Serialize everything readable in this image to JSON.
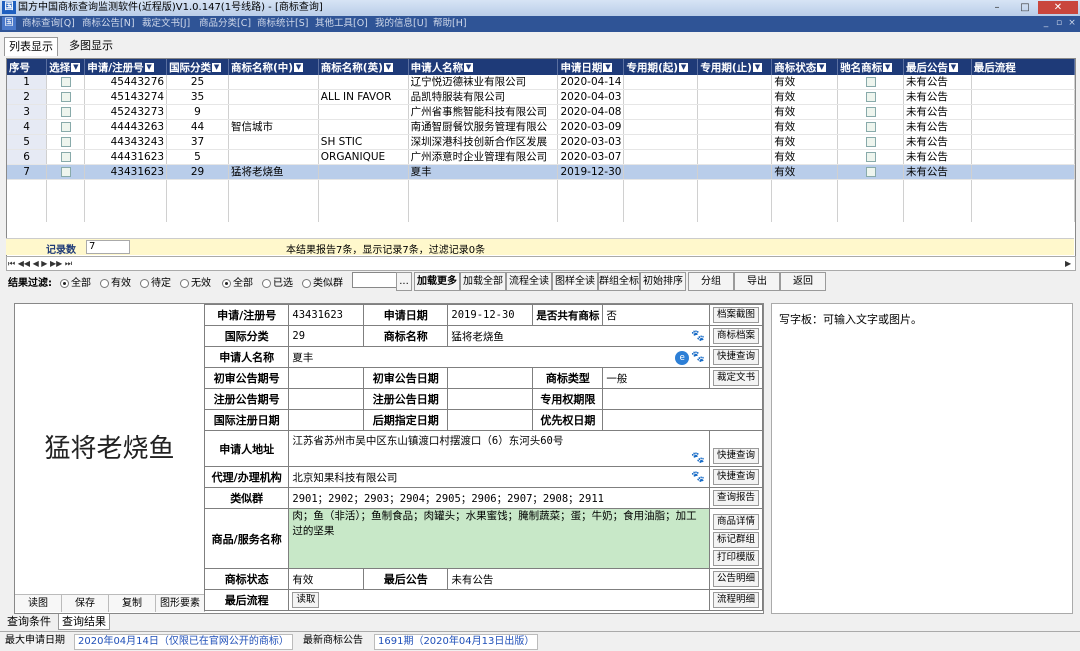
{
  "window": {
    "title": "国方中国商标查询监测软件(近程版)V1.0.147(1号线路) - [商标查询]",
    "app_icon": "国",
    "minimize": "–",
    "maximize": "□",
    "close": "✕"
  },
  "menu": [
    "商标查询[Q]",
    "商标公告[N]",
    "裁定文书[J]",
    "商品分类[C]",
    "商标统计[S]",
    "其他工具[O]",
    "我的信息[U]",
    "帮助[H]"
  ],
  "mdi_controls": [
    "_",
    "▫",
    "×"
  ],
  "view_tabs": {
    "list": "列表显示",
    "multi": "多图显示"
  },
  "grid": {
    "columns": [
      "序号",
      "选择",
      "申请/注册号",
      "国际分类",
      "商标名称(中)",
      "商标名称(英)",
      "申请人名称",
      "申请日期",
      "专用期(起)",
      "专用期(止)",
      "商标状态",
      "驰名商标",
      "最后公告",
      "最后流程"
    ],
    "rows": [
      {
        "no": "1",
        "reg": "45443276",
        "cls": "25",
        "cn": "",
        "en": "",
        "applicant": "辽宁悦迈德袜业有限公司",
        "date": "2020-04-14",
        "status": "有效",
        "notice": "未有公告"
      },
      {
        "no": "2",
        "reg": "45143274",
        "cls": "35",
        "cn": "",
        "en": "ALL IN FAVOR",
        "applicant": "品凯特服装有限公司",
        "date": "2020-04-03",
        "status": "有效",
        "notice": "未有公告"
      },
      {
        "no": "3",
        "reg": "45243273",
        "cls": "9",
        "cn": "",
        "en": "",
        "applicant": "广州省事熊智能科技有限公司",
        "date": "2020-04-08",
        "status": "有效",
        "notice": "未有公告"
      },
      {
        "no": "4",
        "reg": "44443263",
        "cls": "44",
        "cn": "智信城市",
        "en": "",
        "applicant": "南通智厨餐饮服务管理有限公",
        "date": "2020-03-09",
        "status": "有效",
        "notice": "未有公告"
      },
      {
        "no": "5",
        "reg": "44343243",
        "cls": "37",
        "cn": "",
        "en": "SH STIC",
        "applicant": "深圳深港科技创新合作区发展",
        "date": "2020-03-03",
        "status": "有效",
        "notice": "未有公告"
      },
      {
        "no": "6",
        "reg": "44431623",
        "cls": "5",
        "cn": "",
        "en": "ORGANIQUE",
        "applicant": "广州添意时企业管理有限公司",
        "date": "2020-03-07",
        "status": "有效",
        "notice": "未有公告"
      },
      {
        "no": "7",
        "reg": "43431623",
        "cls": "29",
        "cn": "猛将老烧鱼",
        "en": "",
        "applicant": "夏丰",
        "date": "2019-12-30",
        "status": "有效",
        "notice": "未有公告"
      }
    ],
    "selected_row": 7
  },
  "records": {
    "label": "记录数",
    "count": "7",
    "message": "本结果报告7条，显示记录7条，过滤记录0条"
  },
  "scroll_nav": "⏮ ◀◀ ◀ ▶ ▶▶ ⏭",
  "filter": {
    "label": "结果过滤:",
    "group1": [
      "全部",
      "有效",
      "待定",
      "无效"
    ],
    "group1_selected": "全部",
    "group2": [
      "全部",
      "已选",
      "类似群"
    ],
    "group2_selected": "全部",
    "input_value": "",
    "ellipsis": "...",
    "buttons": [
      "加载更多",
      "加载全部",
      "流程全读",
      "图样全读",
      "群组全标",
      "初始排序",
      "分组",
      "导出",
      "返回"
    ]
  },
  "detail": {
    "trademark_big": "猛将老烧鱼",
    "left_buttons": [
      "读图",
      "保存",
      "复制",
      "图形要素"
    ],
    "labels": {
      "reg_no": "申请/注册号",
      "app_date": "申请日期",
      "shared": "是否共有商标",
      "intl_class": "国际分类",
      "tm_name": "商标名称",
      "applicant": "申请人名称",
      "prelim_no": "初审公告期号",
      "prelim_date": "初审公告日期",
      "tm_type": "商标类型",
      "reg_no2": "注册公告期号",
      "reg_date2": "注册公告日期",
      "exclusive": "专用权期限",
      "intl_reg_date": "国际注册日期",
      "later_date": "后期指定日期",
      "priority": "优先权日期",
      "address": "申请人地址",
      "agent": "代理/办理机构",
      "similar": "类似群",
      "goods": "商品/服务名称",
      "status": "商标状态",
      "last_notice": "最后公告",
      "last_flow": "最后流程"
    },
    "values": {
      "reg_no": "43431623",
      "app_date": "2019-12-30",
      "shared": "否",
      "intl_class": "29",
      "tm_name": "猛将老烧鱼",
      "applicant": "夏丰",
      "tm_type": "一般",
      "address": "江苏省苏州市吴中区东山镇渡口村摆渡口（6）东河头60号",
      "agent": "北京知果科技有限公司",
      "similar": "2901；2902；2903；2904；2905；2906；2907；2908；2911",
      "goods": "肉；鱼（非活）；鱼制食品；肉罐头；水果蜜饯；腌制蔬菜；蛋；牛奶；食用油脂；加工过的坚果",
      "status": "有效",
      "last_notice": "未有公告",
      "last_flow": "读取"
    },
    "side_buttons": {
      "archive_shot": "档案截图",
      "tm_archive": "商标档案",
      "quick1": "快捷查询",
      "ruling": "裁定文书",
      "quick2": "快捷查询",
      "quick3": "快捷查询",
      "report": "查询报告",
      "goods_detail": "商品详情",
      "mark_group": "标记群组",
      "print_template": "打印模版",
      "notice_detail": "公告明细",
      "flow_detail": "流程明细"
    }
  },
  "writeboard": {
    "text": "写字板：可输入文字或图片。"
  },
  "bottom_tabs": [
    "查询条件",
    "查询结果"
  ],
  "status": {
    "max_date_label": "最大申请日期",
    "max_date_value": "2020年04月14日（仅限已在官网公开的商标）",
    "latest_notice_label": "最新商标公告",
    "latest_notice_value": "1691期（2020年04月13日出版）"
  },
  "colors": {
    "header_bg": "#1e3a78",
    "selected_row": "#b9cdea",
    "goods_bg": "#c8e8c8",
    "menu_bg": "#2f5496"
  }
}
